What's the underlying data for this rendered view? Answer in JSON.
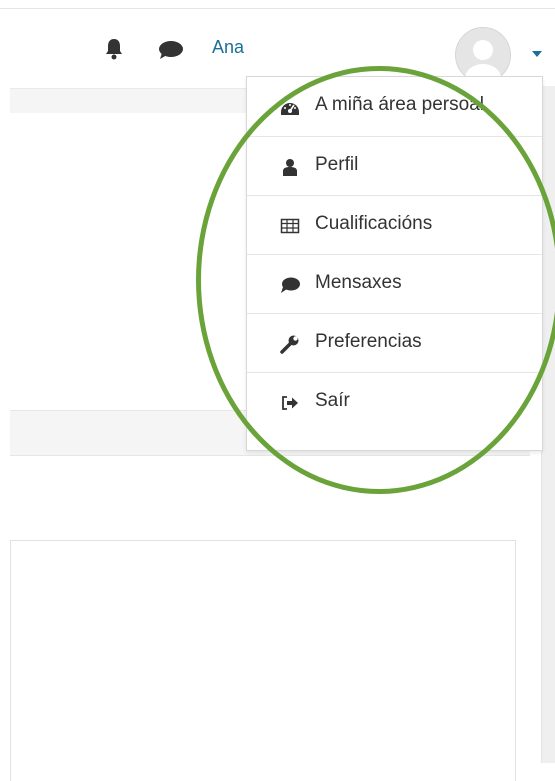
{
  "header": {
    "username": "Ana",
    "icons": [
      "bell-icon",
      "chat-bubble-icon",
      "user-avatar",
      "caret-down-icon"
    ]
  },
  "user_menu": {
    "items": [
      {
        "label": "A miña área persoal",
        "icon": "dashboard-icon"
      },
      {
        "label": "Perfil",
        "icon": "user-icon"
      },
      {
        "label": "Cualificacións",
        "icon": "table-icon"
      },
      {
        "label": "Mensaxes",
        "icon": "chat-bubble-icon"
      },
      {
        "label": "Preferencias",
        "icon": "wrench-icon"
      },
      {
        "label": "Saír",
        "icon": "sign-out-icon"
      }
    ]
  },
  "colors": {
    "link": "#1b6f98",
    "highlight_ring": "#6aa33a",
    "icon": "#333333"
  }
}
